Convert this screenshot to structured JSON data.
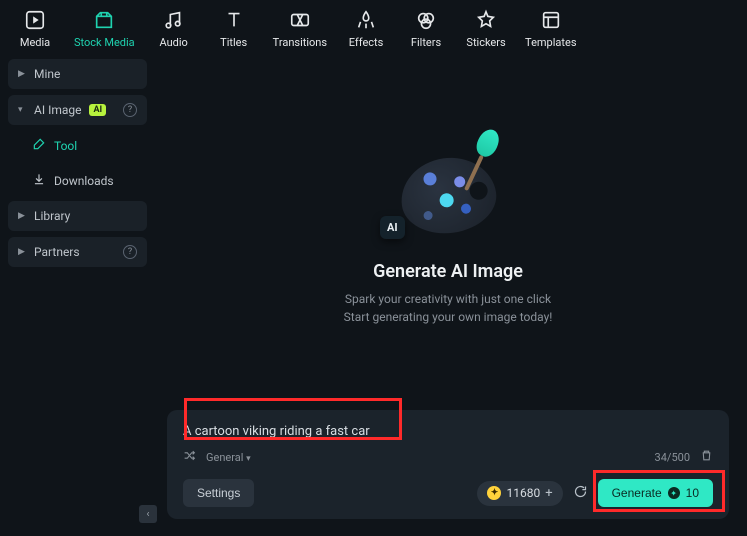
{
  "toolbar": [
    {
      "label": "Media"
    },
    {
      "label": "Stock Media"
    },
    {
      "label": "Audio"
    },
    {
      "label": "Titles"
    },
    {
      "label": "Transitions"
    },
    {
      "label": "Effects"
    },
    {
      "label": "Filters"
    },
    {
      "label": "Stickers"
    },
    {
      "label": "Templates"
    }
  ],
  "sidebar": {
    "mine": "Mine",
    "ai_image": "AI Image",
    "ai_badge": "AI",
    "tool": "Tool",
    "downloads": "Downloads",
    "library": "Library",
    "partners": "Partners"
  },
  "hero": {
    "title": "Generate AI Image",
    "line1": "Spark your creativity with just one click",
    "line2": "Start generating your own image today!",
    "chip": "AI"
  },
  "prompt": {
    "text": "A cartoon viking riding a fast car",
    "preset": "General",
    "count": "34/500",
    "settings": "Settings",
    "credits": "11680",
    "generate": "Generate",
    "cost": "10"
  }
}
